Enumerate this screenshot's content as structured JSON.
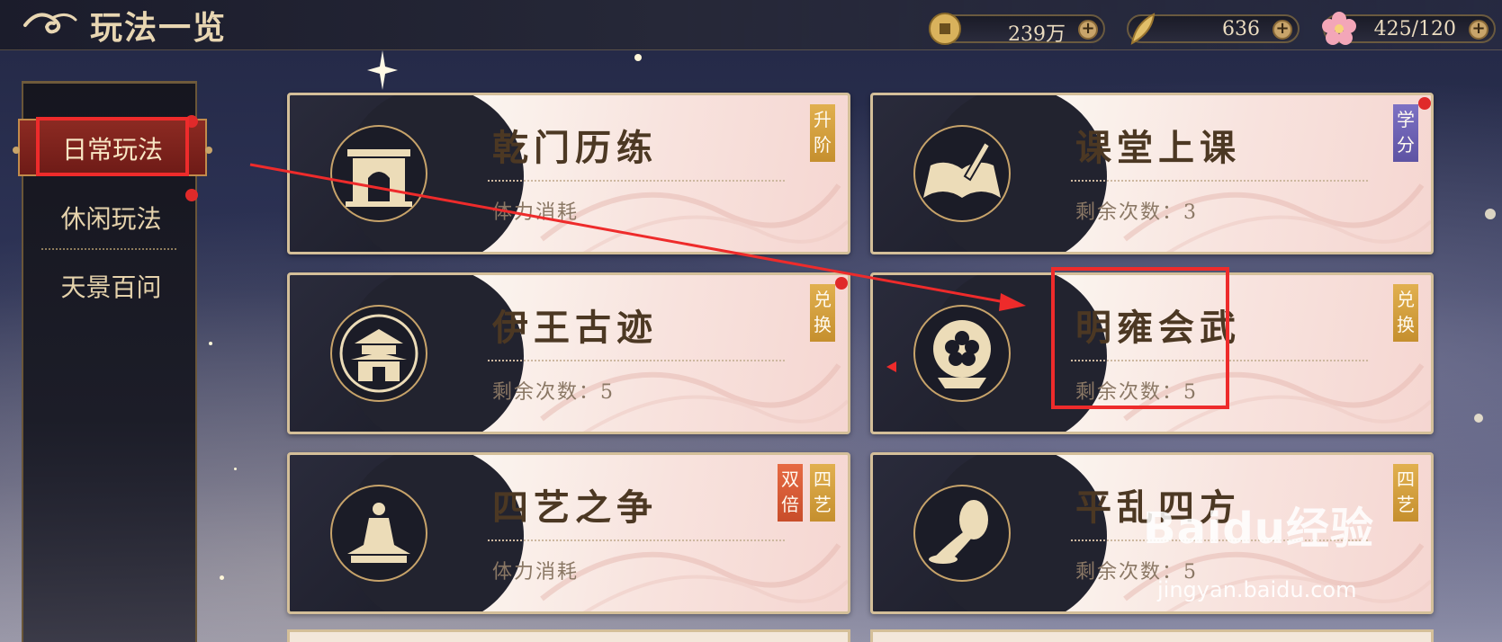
{
  "header": {
    "title": "玩法一览",
    "resources": [
      {
        "icon": "coin-icon",
        "value": "239万"
      },
      {
        "icon": "feather-icon",
        "value": "636"
      },
      {
        "icon": "blossom-icon",
        "value": "425/120"
      }
    ]
  },
  "sidebar": {
    "items": [
      {
        "label": "日常玩法",
        "active": true,
        "red_dot": true
      },
      {
        "label": "休闲玩法",
        "active": false,
        "red_dot": true
      },
      {
        "label": "天景百问",
        "active": false,
        "red_dot": false
      }
    ]
  },
  "cards": [
    {
      "title": "乾门历练",
      "subtitle": "体力消耗",
      "badges": [
        "升阶"
      ],
      "red_dot": false,
      "emblem": "gate-emblem-icon"
    },
    {
      "title": "课堂上课",
      "subtitle": "剩余次数：3",
      "badges": [
        "学分"
      ],
      "red_dot": true,
      "emblem": "book-emblem-icon"
    },
    {
      "title": "伊王古迹",
      "subtitle": "剩余次数：5",
      "badges": [
        "兑换"
      ],
      "red_dot": true,
      "emblem": "pagoda-emblem-icon"
    },
    {
      "title": "明雍会武",
      "subtitle": "剩余次数：5",
      "badges": [
        "兑换"
      ],
      "red_dot": false,
      "emblem": "flower-drum-emblem-icon"
    },
    {
      "title": "四艺之争",
      "subtitle": "体力消耗",
      "badges": [
        "双倍",
        "四艺"
      ],
      "red_dot": false,
      "emblem": "meditating-figure-emblem-icon"
    },
    {
      "title": "平乱四方",
      "subtitle": "剩余次数：5",
      "badges": [
        "四艺"
      ],
      "red_dot": false,
      "emblem": "horn-emblem-icon"
    }
  ],
  "watermark": {
    "brand": "Baidu经验",
    "url": "jingyan.baidu.com"
  },
  "colors": {
    "accent_red": "#ee2b2b",
    "badge_gold": "#c58f2e",
    "badge_purple": "#5e53a3",
    "badge_red": "#c84d2a",
    "title_gold": "#e8d6b2"
  }
}
